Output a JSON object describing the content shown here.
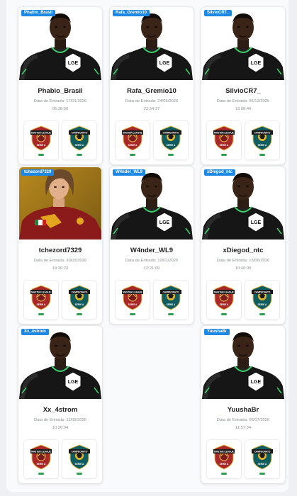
{
  "date_label": "Data de Entrada:",
  "players": [
    {
      "tag": "Phabio_Brasil",
      "name": "Phabio_Brasil",
      "date": "17/01/2026",
      "time": "05:38:50",
      "photo": "pele"
    },
    {
      "tag": "Rafa_Gremio10",
      "name": "Rafa_Gremio10",
      "date": "24/05/2026",
      "time": "22:34:27",
      "photo": "pele"
    },
    {
      "tag": "SilvioCR7_",
      "name": "SilvioCR7_",
      "date": "06/12/2025",
      "time": "13:08:44",
      "photo": "pele"
    },
    {
      "tag": "tchezord7329",
      "name": "tchezord7329",
      "date": "30/03/2026",
      "time": "19:20:23",
      "photo": "roma"
    },
    {
      "tag": "W4nder_WL9",
      "name": "W4nder_WL9",
      "date": "12/01/2026",
      "time": "12:21:09",
      "photo": "pele"
    },
    {
      "tag": "xDiegod_ntc",
      "name": "xDiegod_ntc",
      "date": "15/06/2026",
      "time": "10:40:09",
      "photo": "pele"
    },
    {
      "tag": "Xx_4strom",
      "name": "Xx_4strom",
      "date": "11/05/2026",
      "time": "10:20:04",
      "photo": "pele"
    },
    {
      "tag": "YuushaBr",
      "name": "YuushaBr",
      "date": "06/07/2026",
      "time": "11:57:34",
      "photo": "pele"
    }
  ],
  "badges": {
    "master_league": {
      "top": "MASTER LEAGUE",
      "bottom": "SERIE A",
      "color": "#a8282a"
    },
    "champions": {
      "top": "CAMPEONATO",
      "bottom": "SERIE A",
      "color": "#0f5c61"
    }
  }
}
